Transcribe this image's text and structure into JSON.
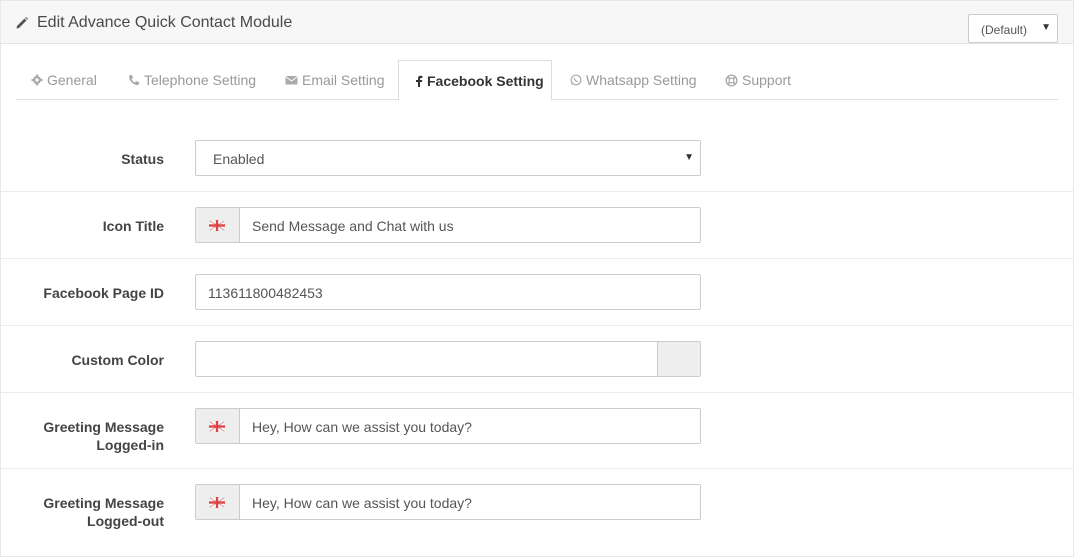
{
  "header": {
    "title": "Edit Advance Quick Contact Module",
    "store_select": "(Default)"
  },
  "tabs": [
    {
      "label": "General",
      "icon": "gear-icon"
    },
    {
      "label": "Telephone Setting",
      "icon": "phone-icon"
    },
    {
      "label": "Email Setting",
      "icon": "envelope-icon"
    },
    {
      "label": "Facebook Setting",
      "icon": "facebook-icon",
      "active": true
    },
    {
      "label": "Whatsapp Setting",
      "icon": "whatsapp-icon"
    },
    {
      "label": "Support",
      "icon": "lifebuoy-icon"
    }
  ],
  "form": {
    "status": {
      "label": "Status",
      "value": "Enabled"
    },
    "icon_title": {
      "label": "Icon Title",
      "value": "Send Message and Chat with us"
    },
    "page_id": {
      "label": "Facebook Page ID",
      "value": "113611800482453"
    },
    "custom_color": {
      "label": "Custom Color",
      "value": ""
    },
    "greeting_in": {
      "label_line1": "Greeting Message",
      "label_line2": "Logged-in",
      "value": "Hey, How can we assist you today?"
    },
    "greeting_out": {
      "label_line1": "Greeting Message",
      "label_line2": "Logged-out",
      "value": "Hey, How can we assist you today?"
    }
  },
  "colors": {
    "heading_bg": "#f7f7f7",
    "addon_bg": "#eeeeee",
    "label": "#444444"
  }
}
